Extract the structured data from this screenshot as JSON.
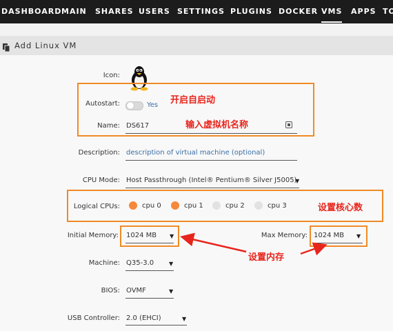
{
  "nav": {
    "items": [
      "DASHBOARD",
      "MAIN",
      "SHARES",
      "USERS",
      "SETTINGS",
      "PLUGINS",
      "DOCKER",
      "VMS",
      "APPS",
      "TO"
    ],
    "active": "VMS"
  },
  "header": {
    "title": "Add Linux VM",
    "icon": "document-icon"
  },
  "form": {
    "icon_label": "Icon:",
    "autostart_label": "Autostart:",
    "autostart_value": "Yes",
    "autostart_on": false,
    "name_label": "Name:",
    "name_value": "DS617",
    "description_label": "Description:",
    "description_value": "description of virtual machine (optional)",
    "cpu_mode_label": "CPU Mode:",
    "cpu_mode_value": "Host Passthrough (Intel® Pentium® Silver J5005)",
    "logical_cpus_label": "Logical CPUs:",
    "cpus": [
      {
        "label": "cpu 0",
        "selected": true
      },
      {
        "label": "cpu 1",
        "selected": true
      },
      {
        "label": "cpu 2",
        "selected": false
      },
      {
        "label": "cpu 3",
        "selected": false
      }
    ],
    "initial_memory_label": "Initial Memory:",
    "initial_memory_value": "1024 MB",
    "max_memory_label": "Max Memory:",
    "max_memory_value": "1024 MB",
    "machine_label": "Machine:",
    "machine_value": "Q35-3.0",
    "bios_label": "BIOS:",
    "bios_value": "OVMF",
    "usb_label": "USB Controller:",
    "usb_value": "2.0 (EHCI)"
  },
  "annotations": {
    "autostart": "开启自启动",
    "name": "输入虚拟机名称",
    "cpus": "设置核心数",
    "memory": "设置内存"
  },
  "colors": {
    "accent_orange": "#f08a24",
    "annotation_red": "#e8251c",
    "link_blue": "#3a6ea5"
  }
}
